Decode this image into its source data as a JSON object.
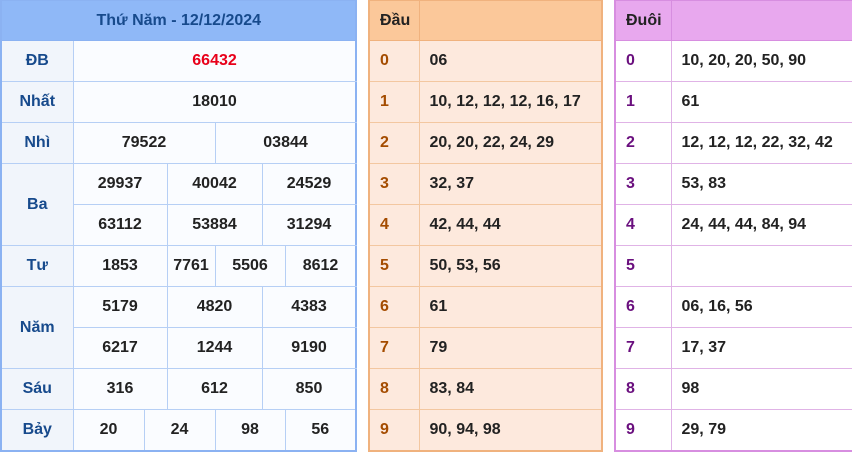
{
  "header": {
    "title": "Thứ Năm - 12/12/2024"
  },
  "prizes": {
    "db": {
      "label": "ĐB",
      "values": [
        "66432"
      ]
    },
    "nhat": {
      "label": "Nhất",
      "values": [
        "18010"
      ]
    },
    "nhi": {
      "label": "Nhì",
      "values": [
        "79522",
        "03844"
      ]
    },
    "ba": {
      "label": "Ba",
      "values": [
        "29937",
        "40042",
        "24529",
        "63112",
        "53884",
        "31294"
      ]
    },
    "tu": {
      "label": "Tư",
      "values": [
        "1853",
        "7761",
        "5506",
        "8612"
      ]
    },
    "nam": {
      "label": "Năm",
      "values": [
        "5179",
        "4820",
        "4383",
        "6217",
        "1244",
        "9190"
      ]
    },
    "sau": {
      "label": "Sáu",
      "values": [
        "316",
        "612",
        "850"
      ]
    },
    "bay": {
      "label": "Bảy",
      "values": [
        "20",
        "24",
        "98",
        "56"
      ]
    }
  },
  "dau": {
    "header": "Đầu",
    "rows": [
      {
        "k": "0",
        "v": "06"
      },
      {
        "k": "1",
        "v": "10, 12, 12, 12, 16, 17"
      },
      {
        "k": "2",
        "v": "20, 20, 22, 24, 29"
      },
      {
        "k": "3",
        "v": "32, 37"
      },
      {
        "k": "4",
        "v": "42, 44, 44"
      },
      {
        "k": "5",
        "v": "50, 53, 56"
      },
      {
        "k": "6",
        "v": "61"
      },
      {
        "k": "7",
        "v": "79"
      },
      {
        "k": "8",
        "v": "83, 84"
      },
      {
        "k": "9",
        "v": "90, 94, 98"
      }
    ]
  },
  "duoi": {
    "header": "Đuôi",
    "rows": [
      {
        "k": "0",
        "v": "10, 20, 20, 50, 90"
      },
      {
        "k": "1",
        "v": "61"
      },
      {
        "k": "2",
        "v": "12, 12, 12, 22, 32, 42"
      },
      {
        "k": "3",
        "v": "53, 83"
      },
      {
        "k": "4",
        "v": "24, 44, 44, 84, 94"
      },
      {
        "k": "5",
        "v": ""
      },
      {
        "k": "6",
        "v": "06, 16, 56"
      },
      {
        "k": "7",
        "v": "17, 37"
      },
      {
        "k": "8",
        "v": "98"
      },
      {
        "k": "9",
        "v": "29, 79"
      }
    ]
  }
}
